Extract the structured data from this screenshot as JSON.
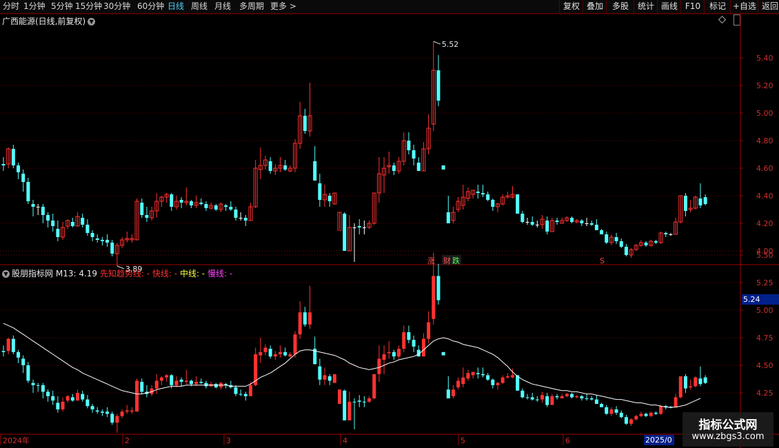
{
  "toolbar": {
    "periods": [
      "分时",
      "1分钟",
      "5分钟",
      "15分钟",
      "30分钟",
      "60分钟",
      "日线",
      "周线",
      "月线",
      "多周期",
      "更多 >"
    ],
    "active_period": "日线",
    "right_buttons": [
      "复权",
      "叠加",
      "多股",
      "统计",
      "画线",
      "F10",
      "标记",
      "+自选",
      "返回"
    ]
  },
  "main_panel": {
    "title": "广西能源(日线,前复权)",
    "y_labels": [
      "5.40",
      "5.20",
      "5.00",
      "4.80",
      "4.60",
      "4.40",
      "4.20",
      "4.00"
    ],
    "high_label": "5.52",
    "low_label": "3.89",
    "markers": {
      "zhang": "涨",
      "cai": "财",
      "die": "跌",
      "s": "S"
    }
  },
  "sub_panel": {
    "name": "股朋指标网",
    "m13": "M13: 4.19",
    "trend": "先知趋势线: -",
    "fast": "快线: -",
    "mid": "中线: -",
    "slow": "慢线: -",
    "y_labels": [
      "5.50",
      "5.25",
      "5.00",
      "4.75",
      "4.50",
      "4.25"
    ],
    "current_value": "5.24"
  },
  "x_axis": {
    "dates": [
      "2024年",
      "2",
      "3",
      "4",
      "5",
      "6"
    ],
    "highlight": "2025/0"
  },
  "watermark": {
    "line1": "指标公式网",
    "line2": "www.zbgs3.com"
  },
  "colors": {
    "up": "#ff3232",
    "down": "#54ffff",
    "grid": "#6b0000",
    "label": "#d03030",
    "line": "#ffffff"
  },
  "chart_data": {
    "type": "candlestick",
    "ohlc": [
      [
        4.63,
        4.68,
        4.58,
        4.62
      ],
      [
        4.63,
        4.75,
        4.6,
        4.74
      ],
      [
        4.74,
        4.77,
        4.6,
        4.62
      ],
      [
        4.62,
        4.64,
        4.52,
        4.57
      ],
      [
        4.56,
        4.59,
        4.43,
        4.5
      ],
      [
        4.5,
        4.53,
        4.34,
        4.36
      ],
      [
        4.34,
        4.37,
        4.25,
        4.32
      ],
      [
        4.32,
        4.34,
        4.26,
        4.32
      ],
      [
        4.32,
        4.34,
        4.2,
        4.26
      ],
      [
        4.26,
        4.28,
        4.17,
        4.22
      ],
      [
        4.22,
        4.27,
        4.14,
        4.18
      ],
      [
        4.16,
        4.22,
        4.07,
        4.1
      ],
      [
        4.1,
        4.21,
        4.08,
        4.17
      ],
      [
        4.18,
        4.23,
        4.16,
        4.22
      ],
      [
        4.21,
        4.24,
        4.17,
        4.18
      ],
      [
        4.18,
        4.28,
        4.18,
        4.25
      ],
      [
        4.24,
        4.27,
        4.17,
        4.19
      ],
      [
        4.19,
        4.23,
        4.11,
        4.13
      ],
      [
        4.13,
        4.15,
        4.07,
        4.1
      ],
      [
        4.09,
        4.12,
        4.06,
        4.08
      ],
      [
        4.08,
        4.1,
        4.04,
        4.07
      ],
      [
        4.08,
        4.12,
        4.03,
        4.06
      ],
      [
        4.06,
        4.08,
        3.96,
        3.98
      ],
      [
        3.98,
        4.06,
        3.89,
        4.04
      ],
      [
        4.04,
        4.1,
        4.02,
        4.08
      ],
      [
        4.08,
        4.14,
        4.06,
        4.09
      ],
      [
        4.08,
        4.12,
        4.06,
        4.09
      ],
      [
        4.08,
        4.38,
        4.08,
        4.36
      ],
      [
        4.35,
        4.38,
        4.24,
        4.26
      ],
      [
        4.26,
        4.32,
        4.21,
        4.24
      ],
      [
        4.24,
        4.32,
        4.22,
        4.29
      ],
      [
        4.29,
        4.42,
        4.24,
        4.36
      ],
      [
        4.36,
        4.4,
        4.32,
        4.39
      ],
      [
        4.39,
        4.42,
        4.35,
        4.41
      ],
      [
        4.41,
        4.42,
        4.29,
        4.32
      ],
      [
        4.32,
        4.4,
        4.3,
        4.36
      ],
      [
        4.37,
        4.39,
        4.31,
        4.35
      ],
      [
        4.35,
        4.46,
        4.33,
        4.36
      ],
      [
        4.36,
        4.37,
        4.31,
        4.33
      ],
      [
        4.33,
        4.4,
        4.31,
        4.35
      ],
      [
        4.35,
        4.38,
        4.33,
        4.34
      ],
      [
        4.34,
        4.36,
        4.29,
        4.31
      ],
      [
        4.31,
        4.35,
        4.3,
        4.33
      ],
      [
        4.33,
        4.34,
        4.29,
        4.3
      ],
      [
        4.3,
        4.35,
        4.28,
        4.34
      ],
      [
        4.33,
        4.34,
        4.29,
        4.32
      ],
      [
        4.32,
        4.36,
        4.29,
        4.3
      ],
      [
        4.3,
        4.32,
        4.22,
        4.24
      ],
      [
        4.24,
        4.28,
        4.22,
        4.24
      ],
      [
        4.24,
        4.26,
        4.18,
        4.22
      ],
      [
        4.22,
        4.35,
        4.22,
        4.32
      ],
      [
        4.32,
        4.66,
        4.31,
        4.6
      ],
      [
        4.59,
        4.75,
        4.52,
        4.62
      ],
      [
        4.62,
        4.69,
        4.59,
        4.66
      ],
      [
        4.65,
        4.68,
        4.56,
        4.58
      ],
      [
        4.58,
        4.63,
        4.55,
        4.6
      ],
      [
        4.6,
        4.68,
        4.57,
        4.62
      ],
      [
        4.62,
        4.66,
        4.58,
        4.59
      ],
      [
        4.58,
        4.62,
        4.57,
        4.6
      ],
      [
        4.6,
        4.81,
        4.57,
        4.78
      ],
      [
        4.78,
        5.08,
        4.74,
        4.98
      ],
      [
        4.98,
        5.03,
        4.85,
        4.87
      ],
      [
        4.87,
        5.22,
        4.83,
        4.98
      ],
      [
        4.65,
        4.76,
        4.51,
        4.51
      ],
      [
        4.49,
        4.56,
        4.32,
        4.37
      ],
      [
        4.37,
        4.48,
        4.32,
        4.41
      ],
      [
        4.4,
        4.42,
        4.32,
        4.36
      ],
      [
        4.34,
        4.42,
        4.34,
        4.42
      ],
      [
        4.15,
        4.28,
        4.16,
        4.28
      ],
      [
        4.27,
        4.28,
        4.0,
        4.0
      ],
      [
        4.0,
        4.26,
        4.0,
        4.17
      ],
      [
        4.17,
        4.2,
        3.92,
        4.17
      ],
      [
        4.18,
        4.23,
        4.12,
        4.17
      ],
      [
        4.17,
        4.22,
        4.12,
        4.17
      ],
      [
        4.17,
        4.22,
        4.16,
        4.2
      ],
      [
        4.2,
        4.42,
        4.19,
        4.42
      ],
      [
        4.42,
        4.68,
        4.35,
        4.56
      ],
      [
        4.55,
        4.68,
        4.42,
        4.6
      ],
      [
        4.61,
        4.72,
        4.56,
        4.62
      ],
      [
        4.62,
        4.64,
        4.55,
        4.58
      ],
      [
        4.58,
        4.68,
        4.56,
        4.65
      ],
      [
        4.65,
        4.86,
        4.62,
        4.8
      ],
      [
        4.8,
        4.86,
        4.7,
        4.73
      ],
      [
        4.73,
        4.77,
        4.62,
        4.67
      ],
      [
        4.64,
        4.68,
        4.58,
        4.58
      ],
      [
        4.58,
        4.79,
        4.58,
        4.74
      ],
      [
        4.74,
        4.99,
        4.7,
        4.89
      ],
      [
        4.92,
        5.52,
        4.87,
        5.31
      ],
      [
        5.31,
        5.42,
        5.05,
        5.09
      ],
      [
        4.62,
        4.62,
        4.59,
        4.59
      ],
      [
        4.28,
        4.4,
        4.21,
        4.2
      ],
      [
        4.22,
        4.32,
        4.2,
        4.28
      ],
      [
        4.3,
        4.39,
        4.28,
        4.36
      ],
      [
        4.33,
        4.48,
        4.3,
        4.39
      ],
      [
        4.38,
        4.46,
        4.36,
        4.43
      ],
      [
        4.41,
        4.44,
        4.38,
        4.44
      ],
      [
        4.43,
        4.48,
        4.38,
        4.42
      ],
      [
        4.42,
        4.48,
        4.39,
        4.41
      ],
      [
        4.41,
        4.43,
        4.36,
        4.37
      ],
      [
        4.37,
        4.38,
        4.29,
        4.32
      ],
      [
        4.32,
        4.35,
        4.28,
        4.34
      ],
      [
        4.34,
        4.41,
        4.33,
        4.39
      ],
      [
        4.39,
        4.43,
        4.38,
        4.4
      ],
      [
        4.39,
        4.47,
        4.38,
        4.41
      ],
      [
        4.41,
        4.41,
        4.27,
        4.27
      ],
      [
        4.27,
        4.29,
        4.2,
        4.21
      ],
      [
        4.21,
        4.24,
        4.19,
        4.21
      ],
      [
        4.21,
        4.25,
        4.18,
        4.19
      ],
      [
        4.19,
        4.22,
        4.17,
        4.19
      ],
      [
        4.19,
        4.26,
        4.16,
        4.23
      ],
      [
        4.22,
        4.25,
        4.12,
        4.14
      ],
      [
        4.14,
        4.24,
        4.14,
        4.22
      ],
      [
        4.22,
        4.24,
        4.19,
        4.21
      ],
      [
        4.2,
        4.24,
        4.2,
        4.22
      ],
      [
        4.22,
        4.25,
        4.21,
        4.24
      ],
      [
        4.24,
        4.25,
        4.2,
        4.21
      ],
      [
        4.21,
        4.23,
        4.2,
        4.22
      ],
      [
        4.22,
        4.23,
        4.18,
        4.2
      ],
      [
        4.2,
        4.24,
        4.18,
        4.2
      ],
      [
        4.2,
        4.22,
        4.18,
        4.19
      ],
      [
        4.19,
        4.23,
        4.15,
        4.15
      ],
      [
        4.15,
        4.16,
        4.12,
        4.12
      ],
      [
        4.12,
        4.14,
        4.05,
        4.06
      ],
      [
        4.06,
        4.12,
        4.04,
        4.1
      ],
      [
        4.1,
        4.13,
        4.05,
        4.07
      ],
      [
        4.07,
        4.09,
        4.02,
        4.03
      ],
      [
        4.03,
        4.05,
        3.96,
        3.97
      ],
      [
        3.97,
        4.02,
        3.95,
        4.01
      ],
      [
        4.01,
        4.05,
        4.0,
        4.04
      ],
      [
        4.04,
        4.08,
        4.03,
        4.06
      ],
      [
        4.06,
        4.07,
        4.03,
        4.04
      ],
      [
        4.04,
        4.08,
        4.03,
        4.07
      ],
      [
        4.07,
        4.08,
        4.05,
        4.06
      ],
      [
        4.06,
        4.14,
        4.05,
        4.13
      ],
      [
        4.13,
        4.14,
        4.1,
        4.12
      ],
      [
        4.12,
        4.13,
        4.11,
        4.12
      ],
      [
        4.12,
        4.24,
        4.12,
        4.21
      ],
      [
        4.21,
        4.4,
        4.2,
        4.4
      ],
      [
        4.4,
        4.42,
        4.25,
        4.29
      ],
      [
        4.3,
        4.37,
        4.28,
        4.31
      ],
      [
        4.31,
        4.4,
        4.3,
        4.39
      ],
      [
        4.38,
        4.49,
        4.31,
        4.33
      ],
      [
        4.39,
        4.41,
        4.33,
        4.34
      ]
    ],
    "indicator_line": [
      4.88,
      4.86,
      4.84,
      4.81,
      4.78,
      4.75,
      4.72,
      4.69,
      4.66,
      4.63,
      4.6,
      4.57,
      4.54,
      4.51,
      4.48,
      4.46,
      4.43,
      4.41,
      4.39,
      4.37,
      4.35,
      4.33,
      4.31,
      4.29,
      4.27,
      4.26,
      4.25,
      4.24,
      4.24,
      4.25,
      4.26,
      4.28,
      4.29,
      4.3,
      4.31,
      4.31,
      4.31,
      4.32,
      4.32,
      4.32,
      4.32,
      4.32,
      4.32,
      4.32,
      4.32,
      4.32,
      4.31,
      4.31,
      4.31,
      4.31,
      4.33,
      4.36,
      4.39,
      4.41,
      4.43,
      4.46,
      4.49,
      4.52,
      4.56,
      4.6,
      4.63,
      4.64,
      4.64,
      4.63,
      4.62,
      4.61,
      4.6,
      4.59,
      4.57,
      4.55,
      4.52,
      4.5,
      4.48,
      4.47,
      4.46,
      4.47,
      4.48,
      4.5,
      4.52,
      4.53,
      4.55,
      4.56,
      4.57,
      4.58,
      4.6,
      4.64,
      4.68,
      4.72,
      4.74,
      4.75,
      4.74,
      4.72,
      4.71,
      4.69,
      4.68,
      4.67,
      4.66,
      4.64,
      4.62,
      4.6,
      4.57,
      4.53,
      4.49,
      4.44,
      4.4,
      4.37,
      4.35,
      4.33,
      4.32,
      4.31,
      4.3,
      4.29,
      4.28,
      4.27,
      4.27,
      4.26,
      4.26,
      4.25,
      4.24,
      4.24,
      4.23,
      4.22,
      4.21,
      4.2,
      4.19,
      4.19,
      4.18,
      4.17,
      4.16,
      4.16,
      4.15,
      4.14,
      4.14,
      4.13,
      4.12,
      4.12,
      4.12,
      4.13,
      4.14,
      4.16,
      4.18,
      4.2
    ],
    "main_ylim": [
      3.9,
      5.6
    ],
    "sub_ylim": [
      4.1,
      5.6
    ],
    "x_labels": [
      "2024年",
      "2",
      "3",
      "4",
      "5",
      "6",
      "2025/0"
    ]
  }
}
